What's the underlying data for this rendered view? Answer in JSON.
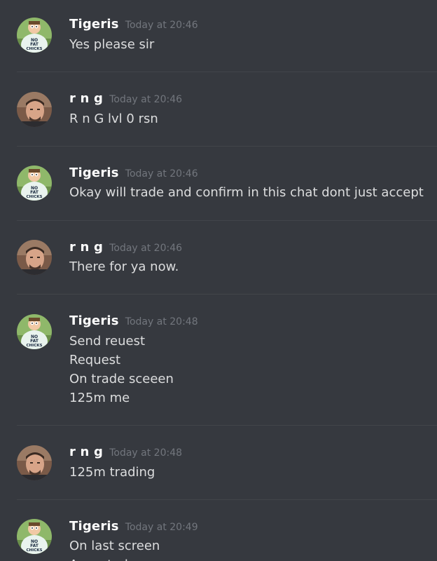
{
  "messages": [
    {
      "author": "Tigeris",
      "avatar_icon": "peter-griffin-avatar-icon",
      "time": "Today at 20:46",
      "lines": [
        "Yes please sir"
      ]
    },
    {
      "author": "r n g",
      "avatar_icon": "user-photo-avatar-icon",
      "time": "Today at 20:46",
      "lines": [
        "R n G lvl 0 rsn"
      ]
    },
    {
      "author": "Tigeris",
      "avatar_icon": "peter-griffin-avatar-icon",
      "time": "Today at 20:46",
      "lines": [
        "Okay will trade and confirm in this chat dont just accept"
      ]
    },
    {
      "author": "r n g",
      "avatar_icon": "user-photo-avatar-icon",
      "time": "Today at 20:46",
      "lines": [
        "There for ya now."
      ]
    },
    {
      "author": "Tigeris",
      "avatar_icon": "peter-griffin-avatar-icon",
      "time": "Today at 20:48",
      "lines": [
        "Send reuest",
        "Request",
        "On trade sceeen",
        "125m me"
      ]
    },
    {
      "author": "r n g",
      "avatar_icon": "user-photo-avatar-icon",
      "time": "Today at 20:48",
      "lines": [
        "125m trading"
      ]
    },
    {
      "author": "Tigeris",
      "avatar_icon": "peter-griffin-avatar-icon",
      "time": "Today at 20:49",
      "lines": [
        "On last screen",
        "Accepted"
      ]
    }
  ],
  "colors": {
    "background": "#36393f",
    "username": "#ffffff",
    "timestamp": "#72767d",
    "message_text": "#dcddde",
    "divider": "#42454a"
  },
  "tigeris_avatar_text": "NO FAT CHICKS"
}
